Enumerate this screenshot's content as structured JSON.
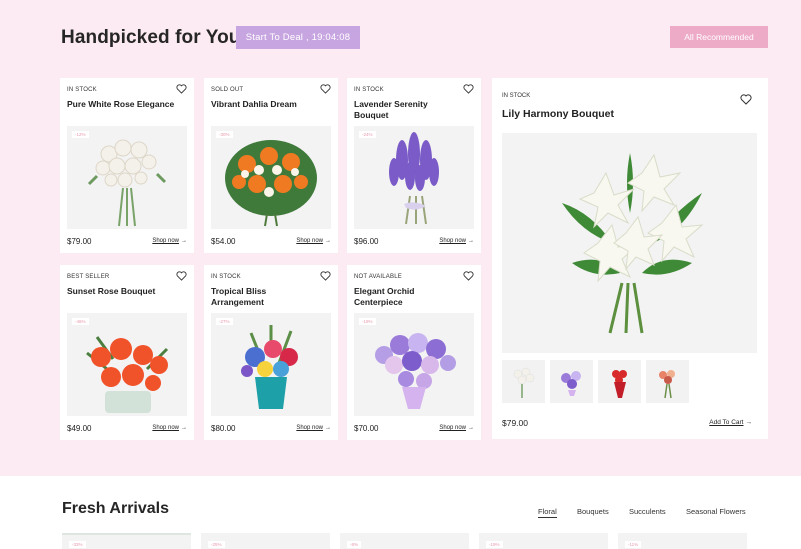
{
  "header": {
    "title": "Handpicked for You",
    "deal_label": "Start To Deal , 19:04:08",
    "recommended_label": "All Recommended"
  },
  "products": [
    {
      "status": "IN STOCK",
      "name": "Pure White Rose Elegance",
      "discount": "-12%",
      "price": "$79.00",
      "shop": "Shop now"
    },
    {
      "status": "SOLD OUT",
      "name": "Vibrant Dahlia Dream",
      "discount": "-30%",
      "price": "$54.00",
      "shop": "Shop now"
    },
    {
      "status": "IN STOCK",
      "name": "Lavender Serenity Bouquet",
      "discount": "-24%",
      "price": "$96.00",
      "shop": "Shop now"
    },
    {
      "status": "BEST SELLER",
      "name": "Sunset Rose Bouquet",
      "discount": "-46%",
      "price": "$49.00",
      "shop": "Shop now"
    },
    {
      "status": "IN STOCK",
      "name": "Tropical Bliss Arrangement",
      "discount": "-27%",
      "price": "$80.00",
      "shop": "Shop now"
    },
    {
      "status": "NOT AVAILABLE",
      "name": "Elegant Orchid Centerpiece",
      "discount": "-19%",
      "price": "$70.00",
      "shop": "Shop now"
    }
  ],
  "featured": {
    "status": "IN STOCK",
    "name": "Lily Harmony Bouquet",
    "price": "$79.00",
    "cart_label": "Add To Cart"
  },
  "fresh": {
    "title": "Fresh Arrivals",
    "tabs": [
      "Floral",
      "Bouquets",
      "Succulents",
      "Seasonal Flowers"
    ],
    "discounts": [
      "-33%",
      "-25%",
      "-8%",
      "-19%",
      "-11%"
    ]
  },
  "icons": {
    "favorite": "heart-icon",
    "arrow": "arrow-right-icon"
  },
  "colors": {
    "background": "#fcebf2",
    "deal": "#c7a5e0",
    "recommended": "#eeabc8"
  }
}
